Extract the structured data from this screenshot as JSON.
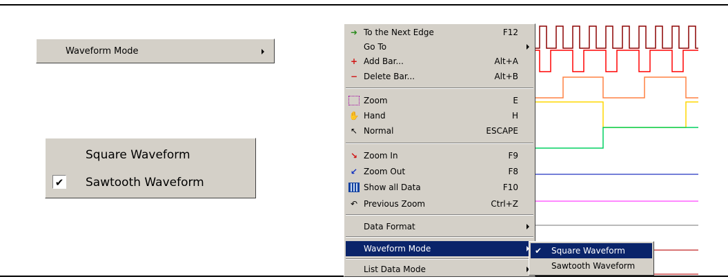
{
  "left_panel": {
    "waveform_mode_label": "Waveform Mode",
    "square_label": "Square Waveform",
    "sawtooth_label": "Sawtooth Waveform",
    "sawtooth_checked": true
  },
  "context_menu": {
    "items": [
      {
        "label": "To the Next Edge",
        "shortcut": "F12",
        "icon": "next-edge-icon"
      },
      {
        "label": "Go To",
        "shortcut": "",
        "icon": "",
        "submenu": true
      },
      {
        "label": "Add Bar...",
        "shortcut": "Alt+A",
        "icon": "add-bar-icon"
      },
      {
        "label": "Delete Bar...",
        "shortcut": "Alt+B",
        "icon": "delete-bar-icon"
      },
      {
        "label": "Zoom",
        "shortcut": "E",
        "icon": "zoom-icon"
      },
      {
        "label": "Hand",
        "shortcut": "H",
        "icon": "hand-icon"
      },
      {
        "label": "Normal",
        "shortcut": "ESCAPE",
        "icon": "arrow-cursor-icon"
      },
      {
        "label": "Zoom In",
        "shortcut": "F9",
        "icon": "zoom-in-icon"
      },
      {
        "label": "Zoom Out",
        "shortcut": "F8",
        "icon": "zoom-out-icon"
      },
      {
        "label": "Show all Data",
        "shortcut": "F10",
        "icon": "show-all-icon"
      },
      {
        "label": "Previous Zoom",
        "shortcut": "Ctrl+Z",
        "icon": "undo-icon"
      },
      {
        "label": "Data Format",
        "shortcut": "",
        "icon": "",
        "submenu": true
      },
      {
        "label": "Waveform Mode",
        "shortcut": "",
        "icon": "",
        "submenu": true,
        "highlighted": true
      },
      {
        "label": "List Data Mode",
        "shortcut": "",
        "icon": "",
        "submenu": true
      }
    ]
  },
  "submenu": {
    "items": [
      {
        "label": "Square Waveform",
        "checked": true,
        "highlighted": true
      },
      {
        "label": "Sawtooth Waveform",
        "checked": false
      }
    ]
  },
  "colors": {
    "menu_bg": "#d4d0c8",
    "highlight": "#0a246a",
    "wave_darkred": "#8b0000",
    "wave_red": "#ff0000",
    "wave_orange": "#ff8040",
    "wave_yellow": "#ffd700",
    "wave_green": "#00d060",
    "wave_blue": "#2030c0",
    "wave_magenta": "#ff40ff",
    "wave_gray": "#909090",
    "wave_red2": "#c02020"
  }
}
